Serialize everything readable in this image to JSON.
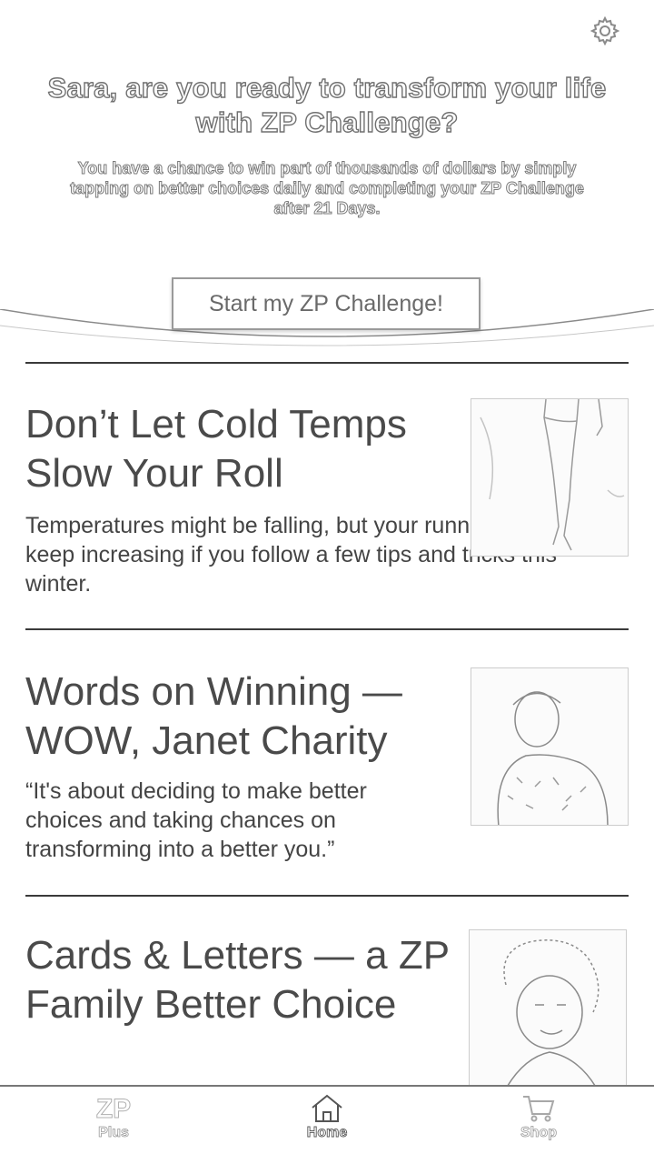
{
  "hero": {
    "title": "Sara, are you ready to transform your life with ZP Challenge?",
    "subtitle": "You have a chance to win part of thousands of dollars by simply tapping on better choices daily and completing your ZP Challenge after 21 Days.",
    "button_label": "Start my ZP Challenge!"
  },
  "articles": [
    {
      "title": "Don’t Let Cold Temps Slow Your Roll",
      "description": "Temperatures might be falling, but your running miles can keep increasing if you follow a few tips and tricks this winter."
    },
    {
      "title": "Words on Winning — WOW, Janet Charity",
      "description": "“It's about deciding to make better choices and taking chances on transforming into a better you.”"
    },
    {
      "title": "Cards & Letters — a ZP Family Better Choice",
      "description": ""
    }
  ],
  "nav": {
    "items": [
      {
        "label": "Plus",
        "icon": "zp-plus-icon"
      },
      {
        "label": "Home",
        "icon": "home-icon"
      },
      {
        "label": "Shop",
        "icon": "cart-icon"
      }
    ],
    "active": "Home"
  },
  "icons": {
    "settings": "gear-icon"
  }
}
